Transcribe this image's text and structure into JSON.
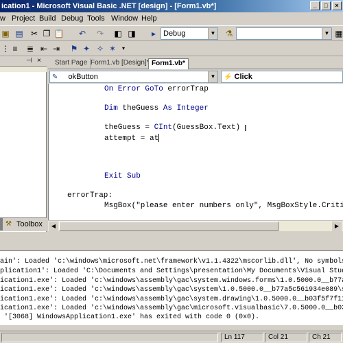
{
  "window": {
    "title": "ication1 - Microsoft Visual Basic .NET [design] - [Form1.vb*]"
  },
  "menu": {
    "items": [
      "w",
      "Project",
      "Build",
      "Debug",
      "Tools",
      "Window",
      "Help"
    ]
  },
  "toolbar": {
    "config_combo": "Debug",
    "find_combo": ""
  },
  "left_panel": {
    "toolbox_label": "Toolbox"
  },
  "doc_tabs": [
    "Start Page",
    "Form1.vb [Design]*",
    "Form1.vb*"
  ],
  "editor": {
    "object_combo": "okButton",
    "event_combo": "Click",
    "lines": [
      {
        "kind": "on_error",
        "kw1": "On Error GoTo",
        "rest": " errorTrap"
      },
      {
        "kind": "dim",
        "kw1": "Dim",
        "mid": " theGuess ",
        "kw2": "As Integer"
      },
      {
        "kind": "assign",
        "text": "theGuess = ",
        "kw": "CInt",
        "rest": "(GuessBox.Text)"
      },
      {
        "kind": "plain",
        "text": "attempt = at"
      },
      {
        "kind": "exit",
        "kw1": "Exit Sub"
      },
      {
        "kind": "label",
        "text": "errorTrap:"
      },
      {
        "kind": "msgbox",
        "text": "MsgBox(\"please enter numbers only\", MsgBoxStyle.Criti"
      }
    ]
  },
  "output": {
    "lines": [
      "ain': Loaded 'c:\\windows\\microsoft.net\\framework\\v1.1.4322\\mscorlib.dll', No symbols lo",
      "plication1': Loaded 'C:\\Documents and Settings\\presentation\\My Documents\\Visual Studio P",
      "ication1.exe': Loaded 'c:\\windows\\assembly\\gac\\system.windows.forms\\1.0.5000.0__b77a5c",
      "ication1.exe': Loaded 'c:\\windows\\assembly\\gac\\system\\1.0.5000.0__b77a5c561934e089\\sys",
      "ication1.exe': Loaded 'c:\\windows\\assembly\\gac\\system.drawing\\1.0.5000.0__b03f5f7f11d5",
      "ication1.exe': Loaded 'c:\\windows\\assembly\\gac\\microsoft.visualbasic\\7.0.5000.0__b03f5",
      " '[3068] WindowsApplication1.exe' has exited with code 0 (0x0)."
    ]
  },
  "status": {
    "line": "Ln 117",
    "col": "Col 21",
    "ch": "Ch 21"
  }
}
